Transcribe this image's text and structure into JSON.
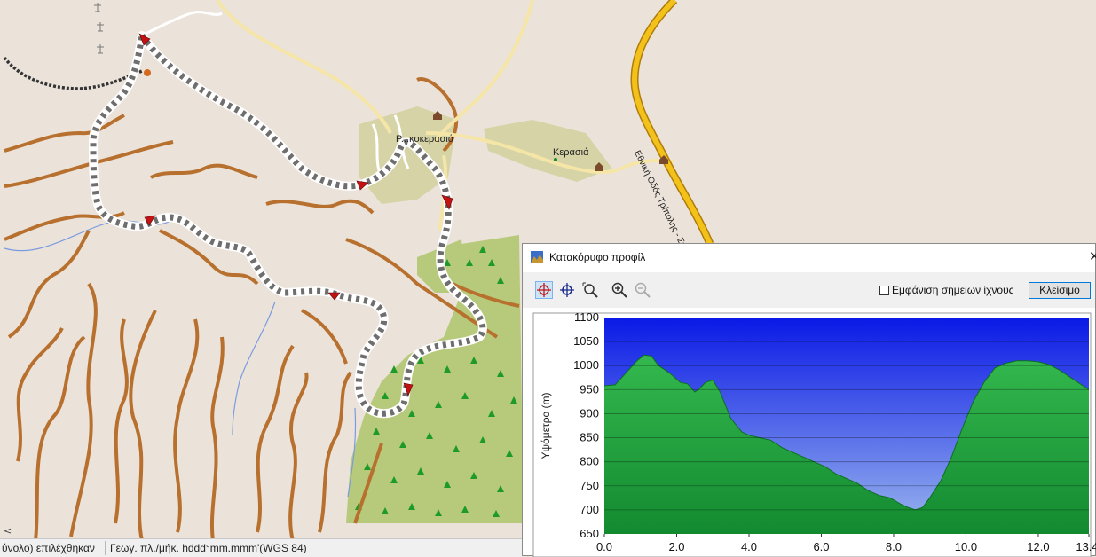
{
  "map": {
    "places": [
      {
        "name": "Ρ...κοκερασιά"
      },
      {
        "name": "Κερασιά"
      }
    ],
    "road_label": "Εθνική Οδός Τρίπολης - Σπάρτης"
  },
  "statusbar": {
    "selection_text": "ύνολο) επιλέχθηκαν",
    "coord_format": "Γεωγ. πλ./μήκ. hddd°mm.mmm'(WGS 84)"
  },
  "dialog": {
    "title": "Κατακόρυφο προφίλ",
    "close_glyph": "✕",
    "toolbar": {
      "icons": [
        "crosshair-red-icon",
        "crosshair-blue-icon",
        "zoom-area-icon",
        "zoom-in-icon",
        "zoom-out-icon"
      ]
    },
    "show_track_points_label": "Εμφάνιση σημείων ίχνους",
    "show_track_points_checked": false,
    "close_button_label": "Κλείσιμο"
  },
  "colors": {
    "sky_top": "#0a19e6",
    "sky_bottom": "#9cb8ee",
    "terrain": "#22a040",
    "track": "#6e6e6e",
    "major_road": "#f2c21a",
    "local_road": "#b8702e"
  },
  "chart_data": {
    "type": "area",
    "xlabel": "",
    "ylabel": "Υψόμετρο (m)",
    "xlim": [
      0,
      13.4
    ],
    "ylim": [
      650,
      1100
    ],
    "x_ticks": [
      "0.0",
      "2.0",
      "4.0",
      "6.0",
      "8.0",
      "10.0",
      "12.0",
      "13.4"
    ],
    "y_ticks": [
      "650",
      "700",
      "750",
      "800",
      "850",
      "900",
      "950",
      "1000",
      "1050",
      "1100"
    ],
    "x": [
      0,
      0.3,
      0.6,
      0.9,
      1.1,
      1.3,
      1.5,
      1.8,
      2.1,
      2.3,
      2.5,
      2.6,
      2.8,
      3.0,
      3.2,
      3.5,
      3.8,
      4.0,
      4.3,
      4.6,
      4.9,
      5.2,
      5.5,
      5.8,
      6.1,
      6.4,
      6.7,
      7.0,
      7.3,
      7.6,
      7.9,
      8.2,
      8.4,
      8.6,
      8.8,
      9.0,
      9.3,
      9.6,
      9.9,
      10.2,
      10.5,
      10.8,
      11.1,
      11.4,
      11.7,
      12.0,
      12.3,
      12.6,
      12.9,
      13.2,
      13.4
    ],
    "series": [
      {
        "values": [
          958,
          960,
          985,
          1010,
          1022,
          1020,
          1000,
          985,
          965,
          962,
          945,
          950,
          965,
          970,
          945,
          890,
          862,
          855,
          850,
          845,
          830,
          820,
          810,
          800,
          790,
          775,
          765,
          755,
          740,
          730,
          725,
          712,
          705,
          700,
          705,
          725,
          760,
          810,
          870,
          925,
          965,
          995,
          1005,
          1010,
          1010,
          1008,
          1002,
          990,
          975,
          960,
          950
        ]
      }
    ]
  }
}
